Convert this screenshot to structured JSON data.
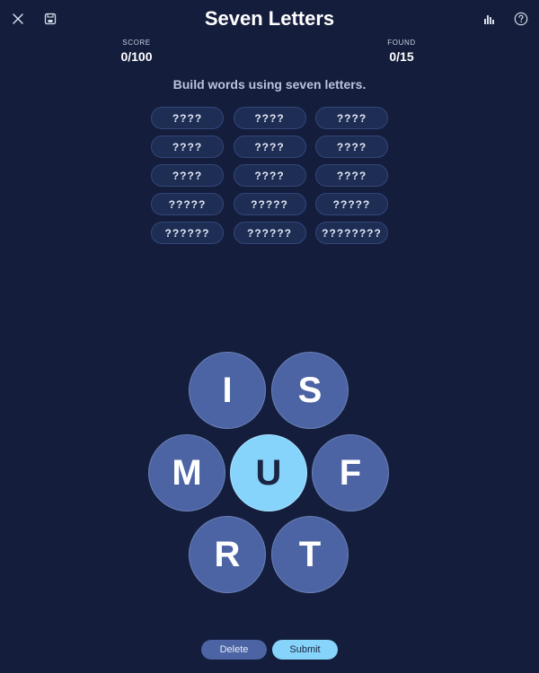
{
  "header": {
    "title": "Seven Letters",
    "icons": [
      "close-icon",
      "save-icon",
      "stats-icon",
      "help-icon"
    ]
  },
  "stats": {
    "score_label": "SCORE",
    "score_value": "0/100",
    "found_label": "FOUND",
    "found_value": "0/15"
  },
  "instructions": "Build words using seven letters.",
  "slots": [
    "????",
    "????",
    "????",
    "????",
    "????",
    "????",
    "????",
    "????",
    "????",
    "?????",
    "?????",
    "?????",
    "??????",
    "??????",
    "????????"
  ],
  "letters": {
    "top_left": "I",
    "top_right": "S",
    "middle_left": "M",
    "center": "U",
    "middle_right": "F",
    "bottom_left": "R",
    "bottom_right": "T"
  },
  "actions": {
    "delete_label": "Delete",
    "submit_label": "Submit"
  },
  "colors": {
    "background": "#141e3c",
    "tile": "#4c64a4",
    "center_tile": "#86d4fb",
    "slot": "#1e2d54"
  }
}
